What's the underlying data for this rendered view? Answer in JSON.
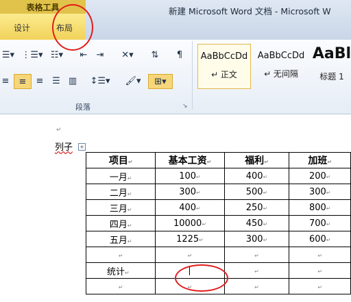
{
  "ribbon_tabs": {
    "context_title": "表格工具",
    "design": "设计",
    "layout": "布局"
  },
  "window_title": "新建 Microsoft Word 文档 - Microsoft W",
  "paragraph_group": {
    "label": "段落",
    "launcher_glyph": "↘"
  },
  "styles": [
    {
      "sample": "AaBbCcDd",
      "name": "↵ 正文",
      "selected": true
    },
    {
      "sample": "AaBbCcDd",
      "name": "↵ 无间隔",
      "selected": false
    },
    {
      "sample": "AaBl",
      "name": "标题 1",
      "selected": false
    }
  ],
  "document": {
    "para_mark": "↵",
    "caption": "列子",
    "move_handle_glyph": "+",
    "table": {
      "headers": [
        "项目",
        "基本工资",
        "福利",
        "加班"
      ],
      "rows": [
        [
          "一月",
          "100",
          "400",
          "200"
        ],
        [
          "二月",
          "300",
          "500",
          "300"
        ],
        [
          "三月",
          "400",
          "250",
          "800"
        ],
        [
          "四月",
          "10000",
          "450",
          "700"
        ],
        [
          "五月",
          "1225",
          "300",
          "600"
        ],
        [
          "",
          "",
          "",
          ""
        ],
        [
          "统计",
          "",
          "",
          ""
        ],
        [
          "",
          "",
          "",
          ""
        ]
      ]
    }
  },
  "colors": {
    "annotation": "#e21b1b",
    "context_tab": "#f8e27a",
    "selected_style_border": "#e2b849"
  }
}
